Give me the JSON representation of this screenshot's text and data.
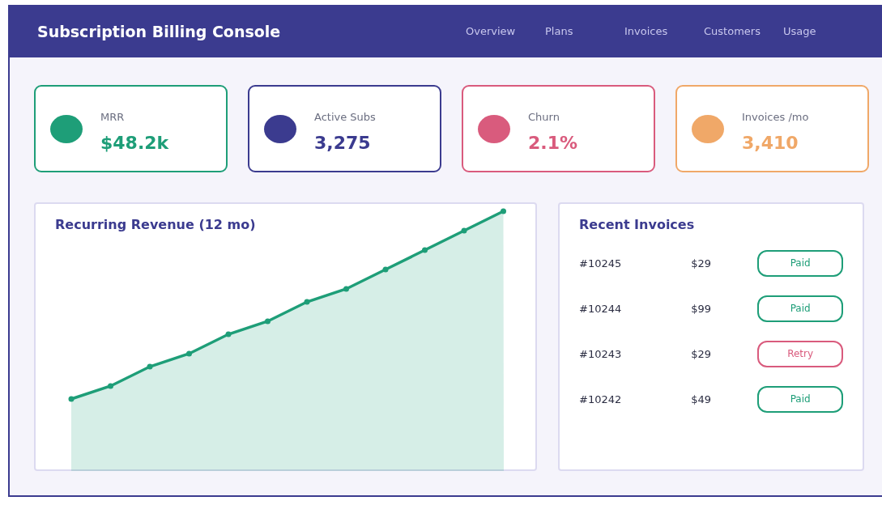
{
  "header": {
    "title": "Subscription Billing Console",
    "nav": [
      "Overview",
      "Plans",
      "Invoices",
      "Customers",
      "Usage"
    ]
  },
  "stats": [
    {
      "label": "MRR",
      "value": "$48.2k",
      "color": "#1e9e78"
    },
    {
      "label": "Active Subs",
      "value": "3,275",
      "color": "#3b3b8f"
    },
    {
      "label": "Churn",
      "value": "2.1%",
      "color": "#d95b7d"
    },
    {
      "label": "Invoices /mo",
      "value": "3,410",
      "color": "#f0a868"
    }
  ],
  "revenue": {
    "title": "Recurring Revenue (12 mo)"
  },
  "invoices": {
    "title": "Recent Invoices",
    "rows": [
      {
        "id": "#10245",
        "amount": "$29",
        "status": "Paid",
        "color": "#1e9e78"
      },
      {
        "id": "#10244",
        "amount": "$99",
        "status": "Paid",
        "color": "#1e9e78"
      },
      {
        "id": "#10243",
        "amount": "$29",
        "status": "Retry",
        "color": "#d95b7d"
      },
      {
        "id": "#10242",
        "amount": "$49",
        "status": "Paid",
        "color": "#1e9e78"
      }
    ]
  }
}
